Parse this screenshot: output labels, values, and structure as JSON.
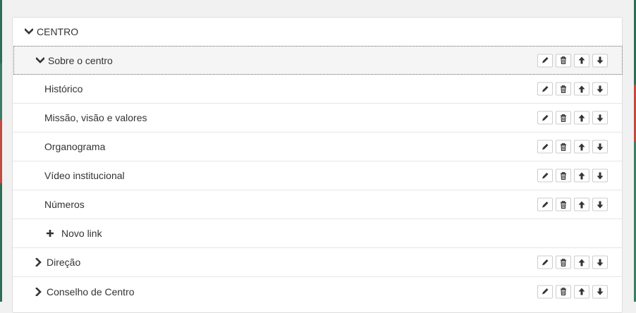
{
  "menu": {
    "root": {
      "label": "CENTRO"
    },
    "items": [
      {
        "label": "Sobre o centro",
        "expanded": true,
        "level": 1
      },
      {
        "label": "Histórico",
        "level": 2
      },
      {
        "label": "Missão, visão e valores",
        "level": 2
      },
      {
        "label": "Organograma",
        "level": 2
      },
      {
        "label": "Vídeo institucional",
        "level": 2
      },
      {
        "label": "Números",
        "level": 2
      },
      {
        "label": "Novo link",
        "level": 2,
        "type": "add"
      },
      {
        "label": "Direção",
        "expanded": false,
        "level": 1
      },
      {
        "label": "Conselho de Centro",
        "expanded": false,
        "level": 1
      }
    ]
  },
  "icons": {
    "expanded": "chevron-down-icon",
    "collapsed": "chevron-right-icon",
    "add": "plus-icon",
    "edit": "pencil-icon",
    "delete": "trash-icon",
    "move_up": "arrow-up-icon",
    "move_down": "arrow-down-icon"
  },
  "colors": {
    "accent_green": "#2f6d55",
    "accent_red": "#c24a3f"
  }
}
